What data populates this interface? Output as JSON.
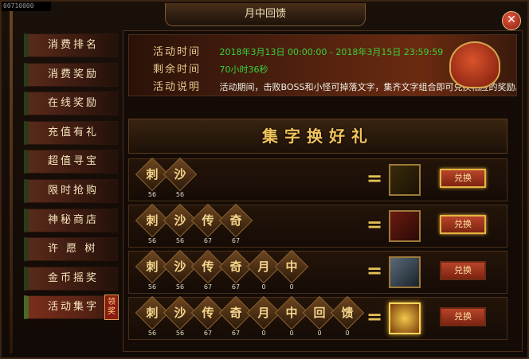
{
  "window": {
    "title": "月中回馈",
    "corner_text": "00710000",
    "close_label": "✕"
  },
  "sidebar": {
    "items": [
      {
        "label": "消费排名"
      },
      {
        "label": "消费奖励"
      },
      {
        "label": "在线奖励"
      },
      {
        "label": "充值有礼"
      },
      {
        "label": "超值寻宝"
      },
      {
        "label": "限时抢购"
      },
      {
        "label": "神秘商店"
      },
      {
        "label": "许 愿 树"
      },
      {
        "label": "金币摇奖"
      },
      {
        "label": "活动集字",
        "badge": "领奖",
        "active": true
      }
    ]
  },
  "banner": {
    "time_key": "活动时间",
    "time_val": "2018年3月13日 00:00:00 - 2018年3月15日 23:59:59",
    "remain_key": "剩余时间",
    "remain_val": "70小时36秒",
    "desc_key": "活动说明",
    "desc_val": "活动期间，击败BOSS和小怪可掉落文字，集齐文字组合即可兑换相应的奖励。"
  },
  "section_title": "集字换好礼",
  "recipes": [
    {
      "chars": [
        {
          "c": "刺",
          "n": "56"
        },
        {
          "c": "沙",
          "n": "56"
        }
      ],
      "reward_icon": "gold-bar-icon",
      "button": "兑换",
      "highlight": true
    },
    {
      "chars": [
        {
          "c": "刺",
          "n": "56"
        },
        {
          "c": "沙",
          "n": "56"
        },
        {
          "c": "传",
          "n": "67"
        },
        {
          "c": "奇",
          "n": "67"
        }
      ],
      "reward_icon": "red-chest-icon",
      "button": "兑换",
      "highlight": true
    },
    {
      "chars": [
        {
          "c": "刺",
          "n": "56"
        },
        {
          "c": "沙",
          "n": "56"
        },
        {
          "c": "传",
          "n": "67"
        },
        {
          "c": "奇",
          "n": "67"
        },
        {
          "c": "月",
          "n": "0"
        },
        {
          "c": "中",
          "n": "0"
        }
      ],
      "reward_icon": "silver-chest-icon",
      "button": "兑换",
      "highlight": false
    },
    {
      "chars": [
        {
          "c": "刺",
          "n": "56"
        },
        {
          "c": "沙",
          "n": "56"
        },
        {
          "c": "传",
          "n": "67"
        },
        {
          "c": "奇",
          "n": "67"
        },
        {
          "c": "月",
          "n": "0"
        },
        {
          "c": "中",
          "n": "0"
        },
        {
          "c": "回",
          "n": "0"
        },
        {
          "c": "馈",
          "n": "0"
        }
      ],
      "reward_icon": "gold-chest-icon",
      "button": "兑换",
      "highlight": false,
      "reward_glow": true
    }
  ],
  "equals": "="
}
